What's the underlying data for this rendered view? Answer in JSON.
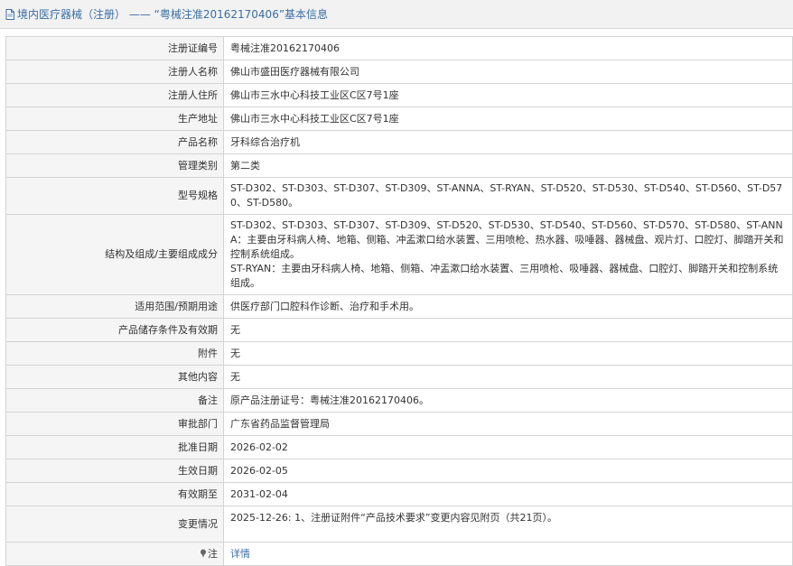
{
  "header": {
    "title": "境内医疗器械（注册） —— “粤械注准20162170406”基本信息"
  },
  "rows": {
    "reg_no": {
      "label": "注册证编号",
      "value": "粤械注准20162170406"
    },
    "registrant": {
      "label": "注册人名称",
      "value": "佛山市盛田医疗器械有限公司"
    },
    "registrant_addr": {
      "label": "注册人住所",
      "value": "佛山市三水中心科技工业区C区7号1座"
    },
    "production_addr": {
      "label": "生产地址",
      "value": "佛山市三水中心科技工业区C区7号1座"
    },
    "product_name": {
      "label": "产品名称",
      "value": "牙科综合治疗机"
    },
    "mgmt_class": {
      "label": "管理类别",
      "value": "第二类"
    },
    "models": {
      "label": "型号规格",
      "value": "ST-D302、ST-D303、ST-D307、ST-D309、ST-ANNA、ST-RYAN、ST-D520、ST-D530、ST-D540、ST-D560、ST-D570、ST-D580。"
    },
    "structure": {
      "label": "结构及组成/主要组成成分",
      "line1": "ST-D302、ST-D303、ST-D307、ST-D309、ST-D520、ST-D530、ST-D540、ST-D560、ST-D570、ST-D580、ST-ANNA：主要由牙科病人椅、地箱、侧箱、冲盂漱口给水装置、三用喷枪、热水器、吸唾器、器械盘、观片灯、口腔灯、脚踏开关和控制系统组成。",
      "line2": "ST-RYAN：主要由牙科病人椅、地箱、侧箱、冲盂漱口给水装置、三用喷枪、吸唾器、器械盘、口腔灯、脚踏开关和控制系统组成。"
    },
    "scope": {
      "label": "适用范围/预期用途",
      "value": "供医疗部门口腔科作诊断、治疗和手术用。"
    },
    "storage": {
      "label": "产品储存条件及有效期",
      "value": "无"
    },
    "attachment": {
      "label": "附件",
      "value": "无"
    },
    "other": {
      "label": "其他内容",
      "value": "无"
    },
    "remark": {
      "label": "备注",
      "value": "原产品注册证号：粤械注准20162170406。"
    },
    "approval_dept": {
      "label": "审批部门",
      "value": "广东省药品监督管理局"
    },
    "approval_date": {
      "label": "批准日期",
      "value": "2026-02-02"
    },
    "effective_date": {
      "label": "生效日期",
      "value": "2026-02-05"
    },
    "expiry_date": {
      "label": "有效期至",
      "value": "2031-02-04"
    },
    "changes": {
      "label": "变更情况",
      "value": "2025-12-26: 1、注册证附件“产品技术要求”变更内容见附页（共21页）。"
    },
    "note": {
      "label": "注",
      "link": "详情"
    }
  },
  "colors": {
    "link": "#3a6ea5",
    "label_bg": "#f5f5f5",
    "border": "#d4d4d4"
  },
  "icons": {
    "header": "document-icon",
    "note": "pin-icon"
  }
}
